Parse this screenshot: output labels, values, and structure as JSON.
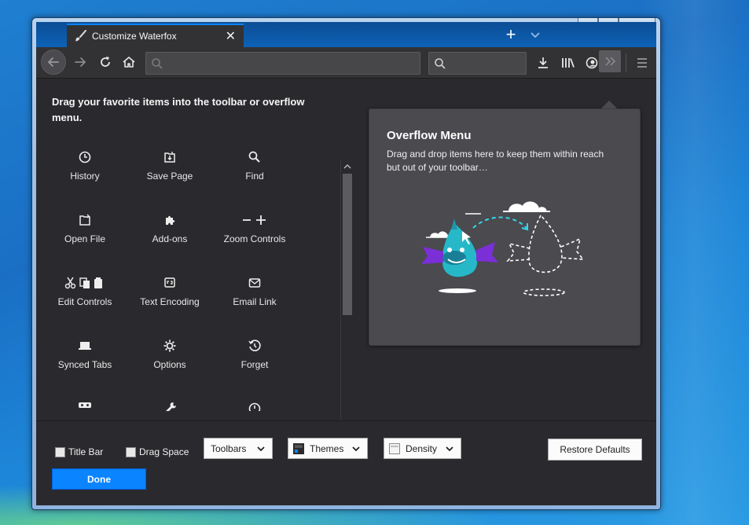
{
  "window": {
    "controls": {
      "minimize": "–",
      "maximize": "▢",
      "close": "✕"
    }
  },
  "tab": {
    "title": "Customize Waterfox",
    "close": "✕"
  },
  "tabstrip": {
    "new_tab": "+"
  },
  "navbar": {
    "url_value": "",
    "search_value": ""
  },
  "customize": {
    "instructions": "Drag your favorite items into the toolbar or overflow menu.",
    "palette_items": [
      {
        "label": "History",
        "icon": "history-icon"
      },
      {
        "label": "Save Page",
        "icon": "save-page-icon"
      },
      {
        "label": "Find",
        "icon": "find-icon"
      },
      {
        "label": "Open File",
        "icon": "open-file-icon"
      },
      {
        "label": "Add-ons",
        "icon": "addons-icon"
      },
      {
        "label": "Zoom Controls",
        "icon": "zoom-controls-icon"
      },
      {
        "label": "Edit Controls",
        "icon": "edit-controls-icon"
      },
      {
        "label": "Text Encoding",
        "icon": "text-encoding-icon"
      },
      {
        "label": "Email Link",
        "icon": "email-link-icon"
      },
      {
        "label": "Synced Tabs",
        "icon": "synced-tabs-icon"
      },
      {
        "label": "Options",
        "icon": "options-icon"
      },
      {
        "label": "Forget",
        "icon": "forget-icon"
      }
    ]
  },
  "overflow_panel": {
    "title": "Overflow Menu",
    "description": "Drag and drop items here to keep them within reach but out of your toolbar…"
  },
  "footer": {
    "title_bar_label": "Title Bar",
    "drag_space_label": "Drag Space",
    "toolbars_label": "Toolbars",
    "themes_label": "Themes",
    "density_label": "Density",
    "restore_label": "Restore Defaults",
    "done_label": "Done"
  },
  "colors": {
    "accent": "#0a84ff",
    "toolbar_bg": "#323234",
    "panel_bg": "#4a4a4f",
    "mascot": "#26b8c8",
    "mascot_wings": "#8a2be2"
  }
}
